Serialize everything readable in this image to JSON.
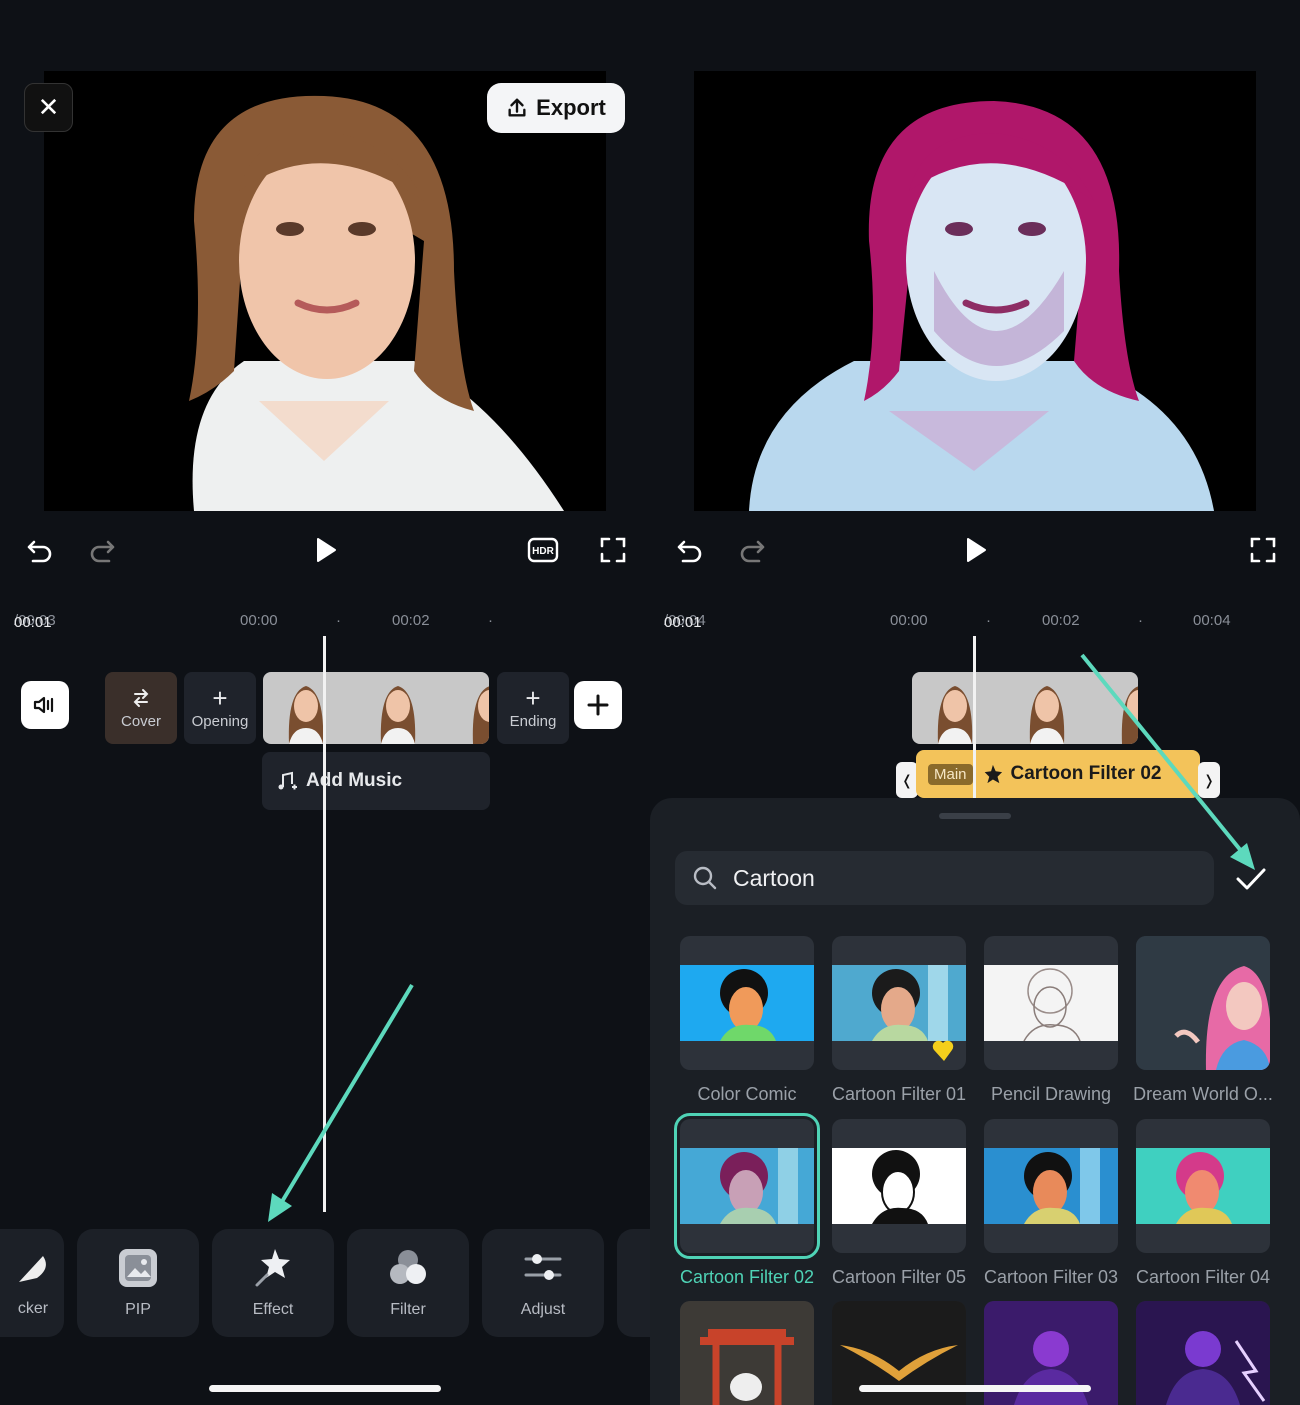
{
  "left": {
    "close_label": "✕",
    "export_label": "Export",
    "timecode_current": "00:01",
    "timecode_total": "/00:03",
    "ruler": [
      "00:00",
      "00:02"
    ],
    "tiles": {
      "cover": "Cover",
      "opening": "Opening",
      "ending": "Ending",
      "plus": "+"
    },
    "add_music_label": "Add Music",
    "toolbar": [
      {
        "label": "cker",
        "icon": "sticker-icon"
      },
      {
        "label": "PIP",
        "icon": "pip-icon"
      },
      {
        "label": "Effect",
        "icon": "effect-icon"
      },
      {
        "label": "Filter",
        "icon": "filter-icon"
      },
      {
        "label": "Adjust",
        "icon": "adjust-icon"
      }
    ]
  },
  "right": {
    "timecode_current": "00:01",
    "timecode_total": "/00:04",
    "ruler": [
      "00:00",
      "00:02",
      "00:04"
    ],
    "effect_strip": {
      "tag": "Main",
      "name": "Cartoon Filter 02",
      "left_bracket": "❬",
      "right_bracket": "❭"
    },
    "search_value": "Cartoon",
    "effects": [
      {
        "label": "Color Comic"
      },
      {
        "label": "Cartoon Filter 01"
      },
      {
        "label": "Pencil Drawing"
      },
      {
        "label": "Dream World O..."
      },
      {
        "label": "Cartoon Filter 02",
        "selected": true
      },
      {
        "label": "Cartoon Filter 05"
      },
      {
        "label": "Cartoon Filter 03"
      },
      {
        "label": "Cartoon Filter 04"
      }
    ]
  },
  "colors": {
    "background": "#0e1116",
    "accent": "#4fd3b6",
    "effect_strip": "#f3c35a",
    "arrow": "#5dd9bd"
  }
}
